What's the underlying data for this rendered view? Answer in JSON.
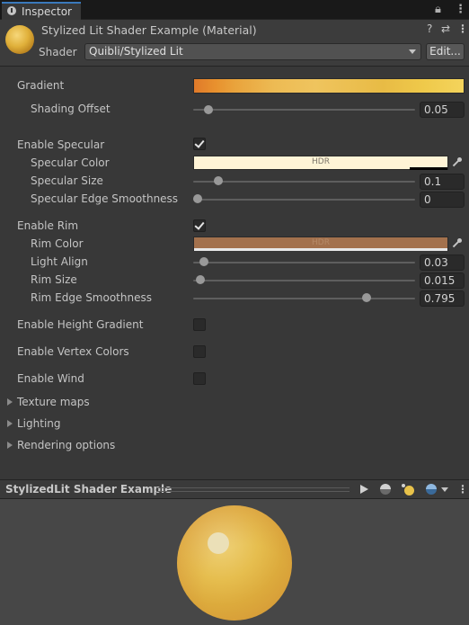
{
  "tab": {
    "label": "Inspector"
  },
  "header": {
    "title": "Stylized Lit Shader Example (Material)",
    "shader_label": "Shader",
    "shader_value": "Quibli/Stylized Lit",
    "edit_label": "Edit..."
  },
  "props": {
    "gradient": {
      "label": "Gradient"
    },
    "shading_offset": {
      "label": "Shading Offset",
      "value": "0.05"
    },
    "enable_specular": {
      "label": "Enable Specular",
      "checked": true
    },
    "specular_color": {
      "label": "Specular Color",
      "hdr": "HDR",
      "color": "#fff4d6"
    },
    "specular_size": {
      "label": "Specular Size",
      "value": "0.1"
    },
    "specular_edge": {
      "label": "Specular Edge Smoothness",
      "value": "0"
    },
    "enable_rim": {
      "label": "Enable Rim",
      "checked": true
    },
    "rim_color": {
      "label": "Rim Color",
      "hdr": "HDR",
      "color": "#a3714d"
    },
    "light_align": {
      "label": "Light Align",
      "value": "0.03"
    },
    "rim_size": {
      "label": "Rim Size",
      "value": "0.015"
    },
    "rim_edge": {
      "label": "Rim Edge Smoothness",
      "value": "0.795"
    },
    "enable_height_gradient": {
      "label": "Enable Height Gradient",
      "checked": false
    },
    "enable_vertex_colors": {
      "label": "Enable Vertex Colors",
      "checked": false
    },
    "enable_wind": {
      "label": "Enable Wind",
      "checked": false
    }
  },
  "foldouts": [
    "Texture maps",
    "Lighting",
    "Rendering options"
  ],
  "preview": {
    "title": "StylizedLit Shader Example"
  },
  "colors": {
    "accent": "#3a79bb",
    "panel": "#383838",
    "field": "#2a2a2a"
  },
  "icons": [
    "info-icon",
    "lock-icon",
    "menu-icon",
    "help-icon",
    "preset-icon",
    "eyedropper-icon",
    "play-icon",
    "sphere-icon",
    "light-icon"
  ]
}
